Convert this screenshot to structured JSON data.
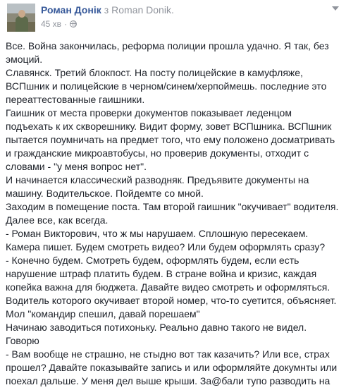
{
  "header": {
    "author": "Роман Донік",
    "separator": "з",
    "alias": "Roman Donik.",
    "time": "45 хв",
    "dot": "·"
  },
  "body": {
    "lines": [
      "Все. Война закончилась, реформа полиции прошла удачно. Я так, без",
      "эмоций.",
      "Славянск. Третий блокпост. На посту полицейские в камуфляже,",
      "ВСПшник и полицейские в черном/синем/херпоймешь. последние это",
      "переаттестованные гаишники.",
      "Гаишник от места проверки документов показывает леденцом",
      "подъехать к их скворешнику. Видит форму, зовет ВСПшника. ВСПшник",
      "пытается поумничать на предмет того, что ему положено досматривать",
      "и гражданские микроавтобусы, но проверив документы, отходит с",
      "словами - \"у меня вопрос нет\".",
      "И начинается классический разводняк. Предъявите документы на",
      "машину. Водительское. Пойдемте со мной.",
      "Заходим в помещение поста. Там второй гаишник \"окучивает\" водителя.",
      "Далее все, как всегда.",
      "- Роман Викторович, что ж мы нарушаем. Сплошную пересекаем.",
      "Камера пишет. Будем смотреть видео? Или будем оформлять сразу?",
      "- Конечно будем. Смотреть будем, оформлять будем, если есть",
      "нарушение штраф платить будем. В стране война и кризис, каждая",
      "копейка важна для бюджета. Давайте видео смотреть и оформляться.",
      "Водитель которого окучивает второй номер, что-то суетится, объясняет.",
      "Мол \"командир спешил, давай порешаем\"",
      "Начинаю заводиться потихоньку. Реально давно такого не видел.",
      "Говорю",
      "- Вам вообще не страшно, не стыдно вот так казачить? Или все, страх",
      "прошел? Давайте показывайте запись и или оформляйте докумнты или",
      "поехал дальше. У меня дел выше крыши. За@бали тупо разводить на"
    ]
  },
  "icons": {
    "globe": "globe-icon",
    "caret": "chevron-down-icon"
  },
  "colors": {
    "link": "#365899",
    "meta": "#90949c",
    "text": "#1d2129"
  }
}
